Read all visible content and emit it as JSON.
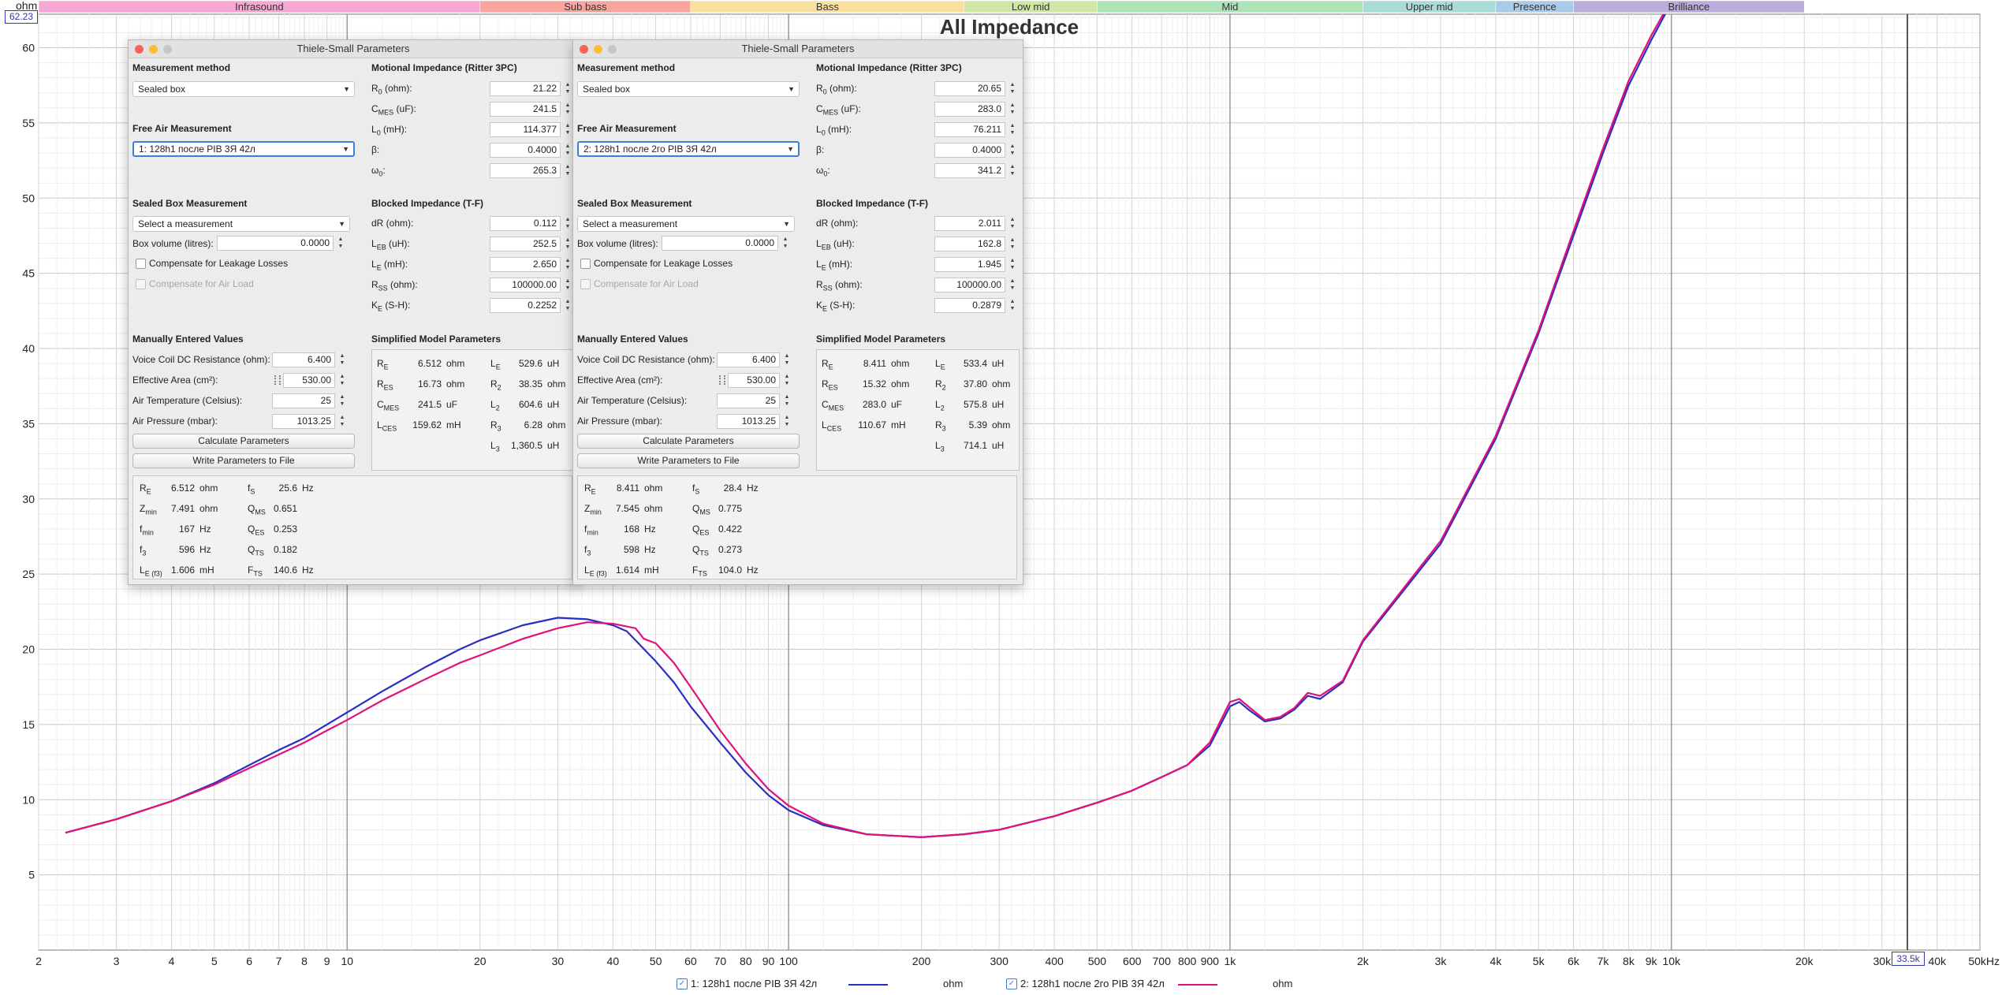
{
  "chart": {
    "title": "All Impedance",
    "y_unit": "ohm",
    "y_cursor": "62.23",
    "x_cursor": "33.5k",
    "bands": [
      {
        "label": "Infrasound",
        "f0": 2,
        "f1": 20,
        "color": "#f6a7d4"
      },
      {
        "label": "Sub bass",
        "f0": 20,
        "f1": 60,
        "color": "#f8a5a0"
      },
      {
        "label": "Bass",
        "f0": 60,
        "f1": 250,
        "color": "#fae09d"
      },
      {
        "label": "Low mid",
        "f0": 250,
        "f1": 500,
        "color": "#cfe6a4"
      },
      {
        "label": "Mid",
        "f0": 500,
        "f1": 2000,
        "color": "#ace4b8"
      },
      {
        "label": "Upper mid",
        "f0": 2000,
        "f1": 4000,
        "color": "#a9dcd9"
      },
      {
        "label": "Presence",
        "f0": 4000,
        "f1": 6000,
        "color": "#a9cbe9"
      },
      {
        "label": "Brilliance",
        "f0": 6000,
        "f1": 20000,
        "color": "#b9addb"
      }
    ],
    "y_ticks": [
      "5",
      "10",
      "15",
      "20",
      "25",
      "30",
      "35",
      "40",
      "45",
      "50",
      "55",
      "60"
    ],
    "x_ticks": [
      {
        "f": 2,
        "t": "2"
      },
      {
        "f": 3,
        "t": "3"
      },
      {
        "f": 4,
        "t": "4"
      },
      {
        "f": 5,
        "t": "5"
      },
      {
        "f": 6,
        "t": "6"
      },
      {
        "f": 7,
        "t": "7"
      },
      {
        "f": 8,
        "t": "8"
      },
      {
        "f": 9,
        "t": "9"
      },
      {
        "f": 10,
        "t": "10"
      },
      {
        "f": 20,
        "t": "20"
      },
      {
        "f": 30,
        "t": "30"
      },
      {
        "f": 40,
        "t": "40"
      },
      {
        "f": 50,
        "t": "50"
      },
      {
        "f": 60,
        "t": "60"
      },
      {
        "f": 70,
        "t": "70"
      },
      {
        "f": 80,
        "t": "80"
      },
      {
        "f": 90,
        "t": "90"
      },
      {
        "f": 100,
        "t": "100"
      },
      {
        "f": 200,
        "t": "200"
      },
      {
        "f": 300,
        "t": "300"
      },
      {
        "f": 400,
        "t": "400"
      },
      {
        "f": 500,
        "t": "500"
      },
      {
        "f": 600,
        "t": "600"
      },
      {
        "f": 700,
        "t": "700"
      },
      {
        "f": 800,
        "t": "800"
      },
      {
        "f": 900,
        "t": "900"
      },
      {
        "f": 1000,
        "t": "1k"
      },
      {
        "f": 2000,
        "t": "2k"
      },
      {
        "f": 3000,
        "t": "3k"
      },
      {
        "f": 4000,
        "t": "4k"
      },
      {
        "f": 5000,
        "t": "5k"
      },
      {
        "f": 6000,
        "t": "6k"
      },
      {
        "f": 7000,
        "t": "7k"
      },
      {
        "f": 8000,
        "t": "8k"
      },
      {
        "f": 9000,
        "t": "9k"
      },
      {
        "f": 10000,
        "t": "10k"
      },
      {
        "f": 20000,
        "t": "20k"
      },
      {
        "f": 30000,
        "t": "30k"
      },
      {
        "f": 40000,
        "t": "40k"
      },
      {
        "f": 50000,
        "t": "50kHz"
      }
    ]
  },
  "chart_data": {
    "type": "line",
    "title": "All Impedance",
    "xlabel": "",
    "ylabel": "ohm",
    "x_scale": "log",
    "xlim": [
      2,
      50000
    ],
    "ylim": [
      0,
      62.23
    ],
    "grid": true,
    "legend": "bottom",
    "series": [
      {
        "name": "1: 128h1 после PIB 3Я 42л",
        "color": "#2a2fc4",
        "points": [
          [
            2.3,
            7.8
          ],
          [
            3,
            8.7
          ],
          [
            4,
            9.9
          ],
          [
            5,
            11.1
          ],
          [
            6,
            12.3
          ],
          [
            7,
            13.3
          ],
          [
            8,
            14.1
          ],
          [
            9,
            15.0
          ],
          [
            10,
            15.8
          ],
          [
            12,
            17.2
          ],
          [
            15,
            18.8
          ],
          [
            18,
            20.0
          ],
          [
            20,
            20.6
          ],
          [
            25,
            21.6
          ],
          [
            30,
            22.1
          ],
          [
            35,
            22.0
          ],
          [
            40,
            21.6
          ],
          [
            43,
            21.2
          ],
          [
            45,
            20.6
          ],
          [
            50,
            19.2
          ],
          [
            55,
            17.8
          ],
          [
            60,
            16.2
          ],
          [
            70,
            13.8
          ],
          [
            80,
            11.8
          ],
          [
            90,
            10.3
          ],
          [
            100,
            9.3
          ],
          [
            120,
            8.3
          ],
          [
            150,
            7.7
          ],
          [
            200,
            7.5
          ],
          [
            250,
            7.7
          ],
          [
            300,
            8.0
          ],
          [
            400,
            8.9
          ],
          [
            500,
            9.8
          ],
          [
            600,
            10.6
          ],
          [
            700,
            11.5
          ],
          [
            800,
            12.3
          ],
          [
            900,
            13.6
          ],
          [
            1000,
            16.2
          ],
          [
            1050,
            16.5
          ],
          [
            1100,
            16.0
          ],
          [
            1200,
            15.2
          ],
          [
            1300,
            15.4
          ],
          [
            1400,
            16.0
          ],
          [
            1500,
            16.9
          ],
          [
            1600,
            16.7
          ],
          [
            1800,
            17.8
          ],
          [
            2000,
            20.5
          ],
          [
            3000,
            27.0
          ],
          [
            4000,
            34.0
          ],
          [
            5000,
            41.0
          ],
          [
            6000,
            47.5
          ],
          [
            7000,
            53.0
          ],
          [
            8000,
            57.5
          ],
          [
            9000,
            60.5
          ],
          [
            10000,
            63.0
          ]
        ]
      },
      {
        "name": "2: 128h1 после 2го PIB 3Я 42л",
        "color": "#e0127a",
        "points": [
          [
            2.3,
            7.8
          ],
          [
            3,
            8.7
          ],
          [
            4,
            9.9
          ],
          [
            5,
            11.0
          ],
          [
            6,
            12.1
          ],
          [
            7,
            13.0
          ],
          [
            8,
            13.8
          ],
          [
            9,
            14.6
          ],
          [
            10,
            15.3
          ],
          [
            12,
            16.6
          ],
          [
            15,
            18.0
          ],
          [
            18,
            19.1
          ],
          [
            20,
            19.6
          ],
          [
            25,
            20.7
          ],
          [
            30,
            21.4
          ],
          [
            35,
            21.8
          ],
          [
            40,
            21.7
          ],
          [
            45,
            21.4
          ],
          [
            47,
            20.7
          ],
          [
            50,
            20.4
          ],
          [
            55,
            19.1
          ],
          [
            60,
            17.5
          ],
          [
            70,
            14.6
          ],
          [
            80,
            12.4
          ],
          [
            90,
            10.7
          ],
          [
            100,
            9.6
          ],
          [
            120,
            8.4
          ],
          [
            150,
            7.7
          ],
          [
            200,
            7.5
          ],
          [
            250,
            7.7
          ],
          [
            300,
            8.0
          ],
          [
            400,
            8.9
          ],
          [
            500,
            9.8
          ],
          [
            600,
            10.6
          ],
          [
            700,
            11.5
          ],
          [
            800,
            12.3
          ],
          [
            900,
            13.8
          ],
          [
            1000,
            16.5
          ],
          [
            1050,
            16.7
          ],
          [
            1100,
            16.2
          ],
          [
            1200,
            15.3
          ],
          [
            1300,
            15.5
          ],
          [
            1400,
            16.1
          ],
          [
            1500,
            17.1
          ],
          [
            1600,
            16.9
          ],
          [
            1800,
            17.9
          ],
          [
            2000,
            20.6
          ],
          [
            3000,
            27.2
          ],
          [
            4000,
            34.2
          ],
          [
            5000,
            41.2
          ],
          [
            6000,
            47.8
          ],
          [
            7000,
            53.3
          ],
          [
            8000,
            57.8
          ],
          [
            9000,
            60.8
          ],
          [
            10000,
            63.2
          ]
        ]
      }
    ]
  },
  "legend": [
    {
      "label": "1: 128h1 после PIB 3Я 42л",
      "unit": "ohm",
      "color": "#2a2fc4"
    },
    {
      "label": "2: 128h1 после 2го PIB 3Я 42л",
      "unit": "ohm",
      "color": "#e0127a"
    }
  ],
  "panels": [
    {
      "title": "Thiele-Small Parameters",
      "s_method": "Measurement method",
      "method_value": "Sealed box",
      "s_free": "Free Air Measurement",
      "free_value": "1: 128h1 после PIB 3Я 42л",
      "s_sealed": "Sealed Box Measurement",
      "sealed_value": "Select a measurement",
      "box_label": "Box volume (litres):",
      "box_value": "0.0000",
      "leak_label": "Compensate for Leakage Losses",
      "air_label": "Compensate for Air Load",
      "s_manual": "Manually Entered Values",
      "vc_label": "Voice Coil DC Resistance (ohm):",
      "vc_value": "6.400",
      "area_label": "Effective Area (cm²):",
      "area_value": "530.00",
      "temp_label": "Air Temperature (Celsius):",
      "temp_value": "25",
      "press_label": "Air Pressure (mbar):",
      "press_value": "1013.25",
      "calc_btn": "Calculate Parameters",
      "write_btn": "Write Parameters to File",
      "s_motional": "Motional Impedance (Ritter 3PC)",
      "motional": [
        {
          "s": "R",
          "sub": "0",
          "u": " (ohm):",
          "v": "21.22"
        },
        {
          "s": "C",
          "sub": "MES",
          "u": " (uF):",
          "v": "241.5"
        },
        {
          "s": "L",
          "sub": "0",
          "u": " (mH):",
          "v": "114.377"
        },
        {
          "s": "β:",
          "sub": "",
          "u": "",
          "v": "0.4000"
        },
        {
          "s": "ω",
          "sub": "0",
          "u": ":",
          "v": "265.3"
        }
      ],
      "s_blocked": "Blocked Impedance (T-F)",
      "blocked": [
        {
          "s": "dR",
          "sub": "",
          "u": " (ohm):",
          "v": "0.112"
        },
        {
          "s": "L",
          "sub": "EB",
          "u": " (uH):",
          "v": "252.5"
        },
        {
          "s": "L",
          "sub": "E",
          "u": " (mH):",
          "v": "2.650"
        },
        {
          "s": "R",
          "sub": "SS",
          "u": " (ohm):",
          "v": "100000.00"
        },
        {
          "s": "K",
          "sub": "E",
          "u": " (S-H):",
          "v": "0.2252"
        }
      ],
      "s_simplified": "Simplified Model Parameters",
      "simp_left": [
        {
          "s": "R",
          "sub": "E",
          "v": "6.512",
          "u": "ohm"
        },
        {
          "s": "R",
          "sub": "ES",
          "v": "16.73",
          "u": "ohm"
        },
        {
          "s": "C",
          "sub": "MES",
          "v": "241.5",
          "u": "uF"
        },
        {
          "s": "L",
          "sub": "CES",
          "v": "159.62",
          "u": "mH"
        }
      ],
      "simp_right": [
        {
          "s": "L",
          "sub": "E",
          "v": "529.6",
          "u": "uH"
        },
        {
          "s": "R",
          "sub": "2",
          "v": "38.35",
          "u": "ohm"
        },
        {
          "s": "L",
          "sub": "2",
          "v": "604.6",
          "u": "uH"
        },
        {
          "s": "R",
          "sub": "3",
          "v": "6.28",
          "u": "ohm"
        },
        {
          "s": "L",
          "sub": "3",
          "v": "1,360.5",
          "u": "uH"
        }
      ],
      "res_left": [
        {
          "s": "R",
          "sub": "E",
          "v": "6.512",
          "u": "ohm"
        },
        {
          "s": "Z",
          "sub": "min",
          "v": "7.491",
          "u": "ohm"
        },
        {
          "s": "f",
          "sub": "min",
          "v": "167",
          "u": "Hz"
        },
        {
          "s": "f",
          "sub": "3",
          "v": "596",
          "u": "Hz"
        },
        {
          "s": "L",
          "sub": "E (f3)",
          "v": "1.606",
          "u": "mH"
        }
      ],
      "res_right": [
        {
          "s": "f",
          "sub": "S",
          "v": "25.6",
          "u": "Hz"
        },
        {
          "s": "Q",
          "sub": "MS",
          "v": "0.651",
          "u": ""
        },
        {
          "s": "Q",
          "sub": "ES",
          "v": "0.253",
          "u": ""
        },
        {
          "s": "Q",
          "sub": "TS",
          "v": "0.182",
          "u": ""
        },
        {
          "s": "F",
          "sub": "TS",
          "v": "140.6",
          "u": "Hz"
        }
      ]
    },
    {
      "title": "Thiele-Small Parameters",
      "s_method": "Measurement method",
      "method_value": "Sealed box",
      "s_free": "Free Air Measurement",
      "free_value": "2: 128h1 после 2го PIB 3Я 42л",
      "s_sealed": "Sealed Box Measurement",
      "sealed_value": "Select a measurement",
      "box_label": "Box volume (litres):",
      "box_value": "0.0000",
      "leak_label": "Compensate for Leakage Losses",
      "air_label": "Compensate for Air Load",
      "s_manual": "Manually Entered Values",
      "vc_label": "Voice Coil DC Resistance (ohm):",
      "vc_value": "6.400",
      "area_label": "Effective Area (cm²):",
      "area_value": "530.00",
      "temp_label": "Air Temperature (Celsius):",
      "temp_value": "25",
      "press_label": "Air Pressure (mbar):",
      "press_value": "1013.25",
      "calc_btn": "Calculate Parameters",
      "write_btn": "Write Parameters to File",
      "s_motional": "Motional Impedance (Ritter 3PC)",
      "motional": [
        {
          "s": "R",
          "sub": "0",
          "u": " (ohm):",
          "v": "20.65"
        },
        {
          "s": "C",
          "sub": "MES",
          "u": " (uF):",
          "v": "283.0"
        },
        {
          "s": "L",
          "sub": "0",
          "u": " (mH):",
          "v": "76.211"
        },
        {
          "s": "β:",
          "sub": "",
          "u": "",
          "v": "0.4000"
        },
        {
          "s": "ω",
          "sub": "0",
          "u": ":",
          "v": "341.2"
        }
      ],
      "s_blocked": "Blocked Impedance (T-F)",
      "blocked": [
        {
          "s": "dR",
          "sub": "",
          "u": " (ohm):",
          "v": "2.011"
        },
        {
          "s": "L",
          "sub": "EB",
          "u": " (uH):",
          "v": "162.8"
        },
        {
          "s": "L",
          "sub": "E",
          "u": " (mH):",
          "v": "1.945"
        },
        {
          "s": "R",
          "sub": "SS",
          "u": " (ohm):",
          "v": "100000.00"
        },
        {
          "s": "K",
          "sub": "E",
          "u": " (S-H):",
          "v": "0.2879"
        }
      ],
      "s_simplified": "Simplified Model Parameters",
      "simp_left": [
        {
          "s": "R",
          "sub": "E",
          "v": "8.411",
          "u": "ohm"
        },
        {
          "s": "R",
          "sub": "ES",
          "v": "15.32",
          "u": "ohm"
        },
        {
          "s": "C",
          "sub": "MES",
          "v": "283.0",
          "u": "uF"
        },
        {
          "s": "L",
          "sub": "CES",
          "v": "110.67",
          "u": "mH"
        }
      ],
      "simp_right": [
        {
          "s": "L",
          "sub": "E",
          "v": "533.4",
          "u": "uH"
        },
        {
          "s": "R",
          "sub": "2",
          "v": "37.80",
          "u": "ohm"
        },
        {
          "s": "L",
          "sub": "2",
          "v": "575.8",
          "u": "uH"
        },
        {
          "s": "R",
          "sub": "3",
          "v": "5.39",
          "u": "ohm"
        },
        {
          "s": "L",
          "sub": "3",
          "v": "714.1",
          "u": "uH"
        }
      ],
      "res_left": [
        {
          "s": "R",
          "sub": "E",
          "v": "8.411",
          "u": "ohm"
        },
        {
          "s": "Z",
          "sub": "min",
          "v": "7.545",
          "u": "ohm"
        },
        {
          "s": "f",
          "sub": "min",
          "v": "168",
          "u": "Hz"
        },
        {
          "s": "f",
          "sub": "3",
          "v": "598",
          "u": "Hz"
        },
        {
          "s": "L",
          "sub": "E (f3)",
          "v": "1.614",
          "u": "mH"
        }
      ],
      "res_right": [
        {
          "s": "f",
          "sub": "S",
          "v": "28.4",
          "u": "Hz"
        },
        {
          "s": "Q",
          "sub": "MS",
          "v": "0.775",
          "u": ""
        },
        {
          "s": "Q",
          "sub": "ES",
          "v": "0.422",
          "u": ""
        },
        {
          "s": "Q",
          "sub": "TS",
          "v": "0.273",
          "u": ""
        },
        {
          "s": "F",
          "sub": "TS",
          "v": "104.0",
          "u": "Hz"
        }
      ]
    }
  ]
}
